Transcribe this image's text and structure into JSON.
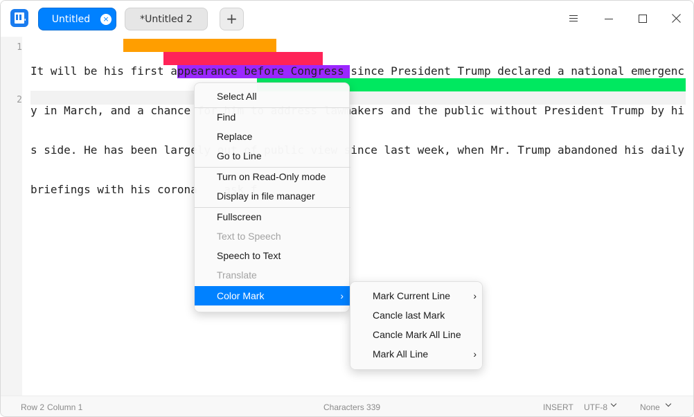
{
  "titlebar": {
    "tabs": [
      {
        "label": "Untitled",
        "active": true,
        "close_glyph": "×"
      },
      {
        "label": "*Untitled 2",
        "active": false
      }
    ],
    "add_tab_glyph": "+",
    "window_buttons": [
      "menu-icon",
      "minimize-icon",
      "maximize-icon",
      "close-icon"
    ]
  },
  "editor": {
    "line_numbers": [
      "1",
      "2"
    ],
    "lines": [
      "It will be his first appearance before Congress since President Trump declared a national emergenc",
      "y in March, and a chance for him to address lawmakers and the public without President Trump by hi",
      "s side. He has been largely out of public view since last week, when Mr. Trump abandoned his daily",
      "briefings with his corona    ask f"
    ],
    "marks": [
      {
        "text": " first appearance befor",
        "color": "#ff9e00"
      },
      {
        "text": "ance for him to address ",
        "color": "#ff2358"
      },
      {
        "text": "rgely out of public view s",
        "color": "#9c27ff"
      },
      {
        "text": "",
        "color": "#00e860"
      }
    ]
  },
  "context_menu": {
    "items": [
      {
        "label": "Select All",
        "enabled": true
      },
      {
        "label": "Find",
        "enabled": true
      },
      {
        "label": "Replace",
        "enabled": true
      },
      {
        "label": "Go to Line",
        "enabled": true
      },
      {
        "label": "Turn on Read-Only mode",
        "enabled": true
      },
      {
        "label": "Display in file manager",
        "enabled": true
      },
      {
        "label": "Fullscreen",
        "enabled": true
      },
      {
        "label": "Text to Speech",
        "enabled": false
      },
      {
        "label": "Speech to Text",
        "enabled": true
      },
      {
        "label": "Translate",
        "enabled": false
      },
      {
        "label": "Color Mark",
        "enabled": true,
        "selected": true,
        "has_submenu": true
      }
    ],
    "submenu_arrow": "›"
  },
  "color_mark_submenu": {
    "items": [
      {
        "label": "Mark Current Line",
        "has_submenu": true
      },
      {
        "label": "Cancle last Mark",
        "has_submenu": false
      },
      {
        "label": "Cancle Mark All Line",
        "has_submenu": false
      },
      {
        "label": "Mark All Line",
        "has_submenu": true
      }
    ]
  },
  "statusbar": {
    "row": "Row 2",
    "column": "Column 1",
    "characters": "Characters 339",
    "mode": "INSERT",
    "encoding": "UTF-8",
    "highlight": "None"
  }
}
